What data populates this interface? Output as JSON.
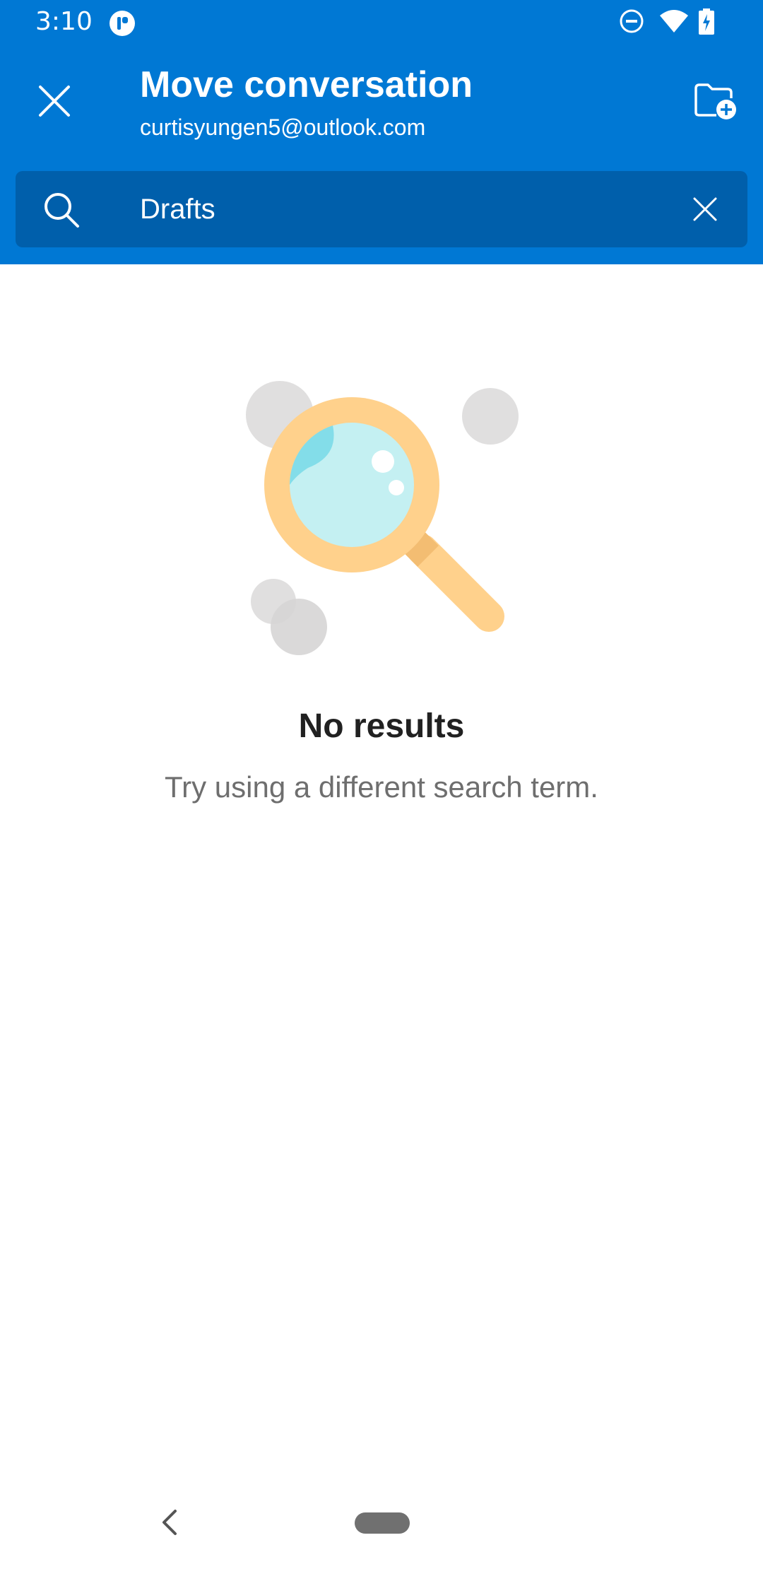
{
  "status_bar": {
    "time": "3:10",
    "icons": [
      "app-notification-icon",
      "do-not-disturb-icon",
      "wifi-icon",
      "battery-charging-icon"
    ]
  },
  "header": {
    "close_icon": "close-icon",
    "title": "Move conversation",
    "subtitle": "curtisyungen5@outlook.com",
    "new_folder_icon": "folder-add-icon"
  },
  "search": {
    "icon": "search-icon",
    "value": "Drafts",
    "clear_icon": "close-icon"
  },
  "empty_state": {
    "illustration": "magnifying-glass-illustration",
    "title": "No results",
    "message": "Try using a different search term."
  },
  "nav_bar": {
    "back_icon": "back-chevron-icon",
    "home_pill": "home-pill"
  },
  "colors": {
    "header_bg": "#0078d4",
    "search_bg": "#005fab",
    "title_text": "#212121",
    "subtitle_text": "#6e6e6e"
  }
}
